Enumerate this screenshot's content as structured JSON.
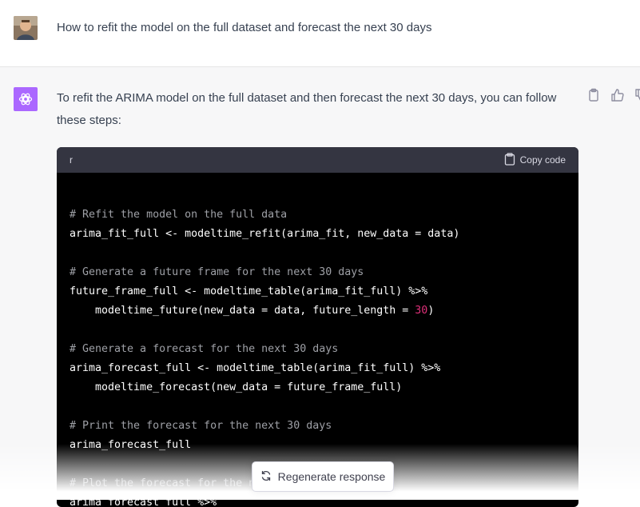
{
  "user": {
    "message": "How to refit the model on the full dataset and forecast the next 30 days"
  },
  "assistant": {
    "intro": "To refit the ARIMA model on the full dataset and then forecast the next 30 days, you can follow these steps:",
    "code": {
      "language": "r",
      "copy_label": "Copy code",
      "lines": [
        {
          "parts": []
        },
        {
          "parts": [
            {
              "t": "# Refit the model on the full data",
              "k": "comment"
            }
          ]
        },
        {
          "parts": [
            {
              "t": "arima_fit_full <- modeltime_refit(arima_fit, new_data = data)",
              "k": "code"
            }
          ]
        },
        {
          "parts": []
        },
        {
          "parts": [
            {
              "t": "# Generate a future frame for the next 30 days",
              "k": "comment"
            }
          ]
        },
        {
          "parts": [
            {
              "t": "future_frame_full <- modeltime_table(arima_fit_full) %>%",
              "k": "code"
            }
          ]
        },
        {
          "parts": [
            {
              "t": "    modeltime_future(new_data = data, future_length = ",
              "k": "code"
            },
            {
              "t": "30",
              "k": "num"
            },
            {
              "t": ")",
              "k": "code"
            }
          ]
        },
        {
          "parts": []
        },
        {
          "parts": [
            {
              "t": "# Generate a forecast for the next 30 days",
              "k": "comment"
            }
          ]
        },
        {
          "parts": [
            {
              "t": "arima_forecast_full <- modeltime_table(arima_fit_full) %>%",
              "k": "code"
            }
          ]
        },
        {
          "parts": [
            {
              "t": "    modeltime_forecast(new_data = future_frame_full)",
              "k": "code"
            }
          ]
        },
        {
          "parts": []
        },
        {
          "parts": [
            {
              "t": "# Print the forecast for the next 30 days",
              "k": "comment"
            }
          ]
        },
        {
          "parts": [
            {
              "t": "arima_forecast_full",
              "k": "code"
            }
          ]
        },
        {
          "parts": []
        },
        {
          "parts": [
            {
              "t": "# Plot the forecast for the next 30 days",
              "k": "comment"
            }
          ]
        },
        {
          "parts": [
            {
              "t": "arima_forecast_full %>%",
              "k": "code"
            }
          ]
        }
      ]
    }
  },
  "regenerate_label": "Regenerate response",
  "icons": {
    "copy": "clipboard-icon",
    "like": "thumbs-up-icon",
    "dislike": "thumbs-down-icon",
    "regenerate": "refresh-icon"
  },
  "colors": {
    "brand": "#ab68ff",
    "code_bg": "#000000",
    "code_header": "#343541",
    "number": "#df3079",
    "comment": "#9ea0a6"
  }
}
